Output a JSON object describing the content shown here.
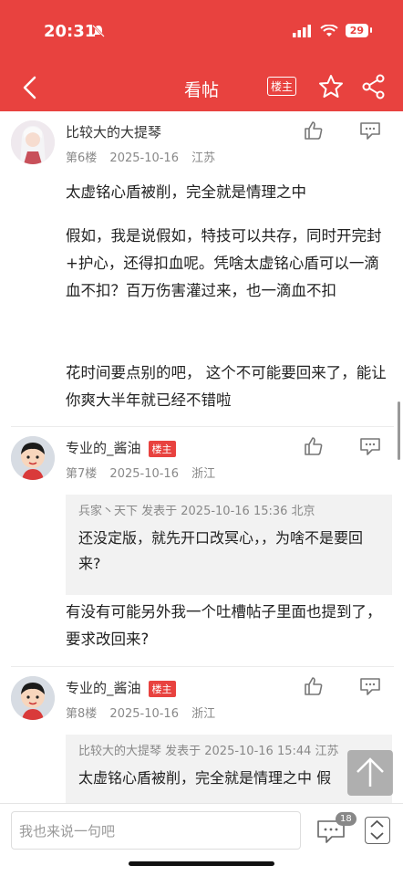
{
  "status": {
    "time": "20:31",
    "battery": "29"
  },
  "nav": {
    "title": "看帖",
    "louzhu_label": "楼主"
  },
  "posts": [
    {
      "user": "比较大的大提琴",
      "floor": "第6楼",
      "date": "2025-10-16",
      "location": "江苏",
      "paragraphs": [
        "太虚铭心盾被削，完全就是情理之中",
        "假如，我是说假如，特技可以共存，同时开完封+护心，还得扣血呢。凭啥太虚铭心盾可以一滴血不扣？百万伤害灌过来，也一滴血不扣",
        "花时间要点别的吧，  这个不可能要回来了，能让你爽大半年就已经不错啦"
      ]
    },
    {
      "user": "专业的_酱油",
      "badge": "楼主",
      "floor": "第7楼",
      "date": "2025-10-16",
      "location": "浙江",
      "quote": {
        "head": "兵家丶天下 发表于 2025-10-16 15:36 北京",
        "text": " 还没定版，就先开口改冥心，，为啥不是要回来?"
      },
      "paragraphs": [
        "有没有可能另外我一个吐槽帖子里面也提到了，要求改回来?"
      ]
    },
    {
      "user": "专业的_酱油",
      "badge": "楼主",
      "floor": "第8楼",
      "date": "2025-10-16",
      "location": "浙江",
      "quote": {
        "head": "比较大的大提琴 发表于 2025-10-16 15:44 江苏",
        "text": " 太虚铭心盾被削，完全就是情理之中 假"
      }
    }
  ],
  "bottom": {
    "placeholder": "我也来说一句吧",
    "comment_count": "18"
  },
  "colors": {
    "brand": "#e8423f"
  }
}
